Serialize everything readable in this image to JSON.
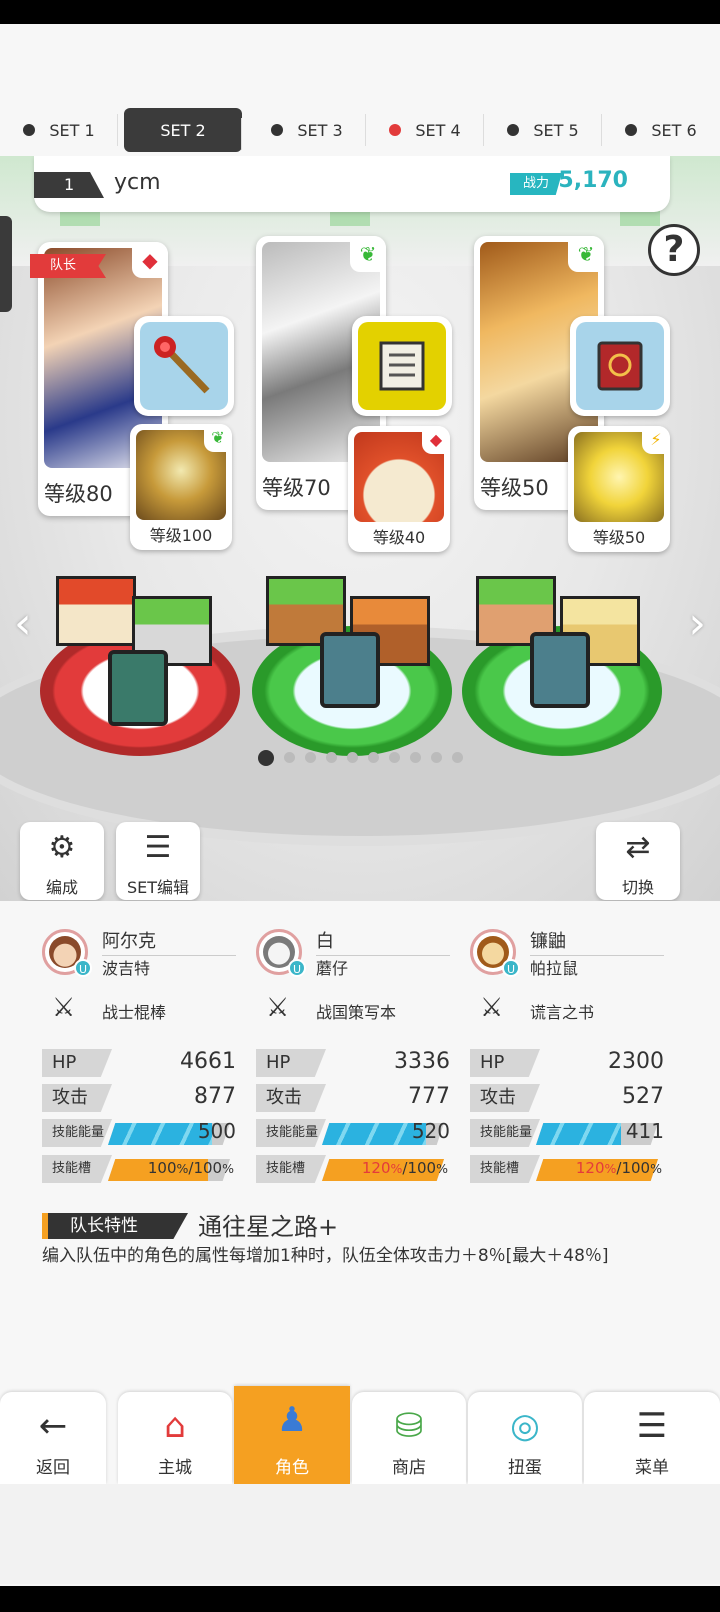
{
  "set_tabs": [
    "SET 1",
    "SET 2",
    "SET 3",
    "SET 4",
    "SET 5",
    "SET 6"
  ],
  "active_set": "SET 2",
  "team": {
    "number": "1",
    "name": "ycm",
    "power_label": "战力",
    "power_value": "5,170"
  },
  "help_label": "?",
  "leader_flag": "队长",
  "characters": [
    {
      "level": "等级80",
      "sub_level": "等级100",
      "attr": "red",
      "sub_attr": "green"
    },
    {
      "level": "等级70",
      "sub_level": "等级40",
      "attr": "green",
      "sub_attr": "red"
    },
    {
      "level": "等级50",
      "sub_level": "等级50",
      "attr": "green",
      "sub_attr": "yellow"
    }
  ],
  "tools": {
    "formation_label": "编成",
    "set_edit_label": "SET编辑",
    "switch_label": "切换"
  },
  "stats": [
    {
      "name": "阿尔克",
      "species": "波吉特",
      "weapon": "战士棍棒",
      "hp_label": "HP",
      "hp": "4661",
      "atk_label": "攻击",
      "atk": "877",
      "energy_label": "技能能量",
      "energy": "500",
      "energy_fill": 0.85,
      "slot_label": "技能槽",
      "slot_current": "100",
      "slot_max": "100",
      "slot_fill": 0.82
    },
    {
      "name": "白",
      "species": "蘑仔",
      "weapon": "战国策写本",
      "hp_label": "HP",
      "hp": "3336",
      "atk_label": "攻击",
      "atk": "777",
      "energy_label": "技能能量",
      "energy": "520",
      "energy_fill": 0.85,
      "slot_label": "技能槽",
      "slot_current": "120",
      "slot_max": "100",
      "slot_fill": 1.0
    },
    {
      "name": "镰鼬",
      "species": "帕拉鼠",
      "weapon": "谎言之书",
      "hp_label": "HP",
      "hp": "2300",
      "atk_label": "攻击",
      "atk": "527",
      "energy_label": "技能能量",
      "energy": "411",
      "energy_fill": 0.7,
      "slot_label": "技能槽",
      "slot_current": "120",
      "slot_max": "100",
      "slot_fill": 1.0
    }
  ],
  "percent_symbol": "%",
  "slash": "/",
  "leader_skill": {
    "tag": "队长特性",
    "title": "通往星之路+",
    "description": "编入队伍中的角色的属性每增加1种时，队伍全体攻击力＋8％[最大＋48％]"
  },
  "bottom_nav": [
    {
      "label": "返回",
      "icon": "back-arrow-icon",
      "glyph": "←"
    },
    {
      "label": "主城",
      "icon": "castle-icon",
      "glyph": "⌂"
    },
    {
      "label": "角色",
      "icon": "character-icon",
      "glyph": "♟"
    },
    {
      "label": "商店",
      "icon": "shop-icon",
      "glyph": "⛁"
    },
    {
      "label": "扭蛋",
      "icon": "gacha-icon",
      "glyph": "◎"
    },
    {
      "label": "菜单",
      "icon": "menu-icon",
      "glyph": "☰"
    }
  ],
  "colors": {
    "accent_orange": "#f5a021",
    "power_teal": "#2bb3be",
    "energy_blue": "#2bb2e0",
    "attr_red": "#e0303a",
    "attr_green": "#38b838",
    "attr_yellow": "#f2b400"
  }
}
